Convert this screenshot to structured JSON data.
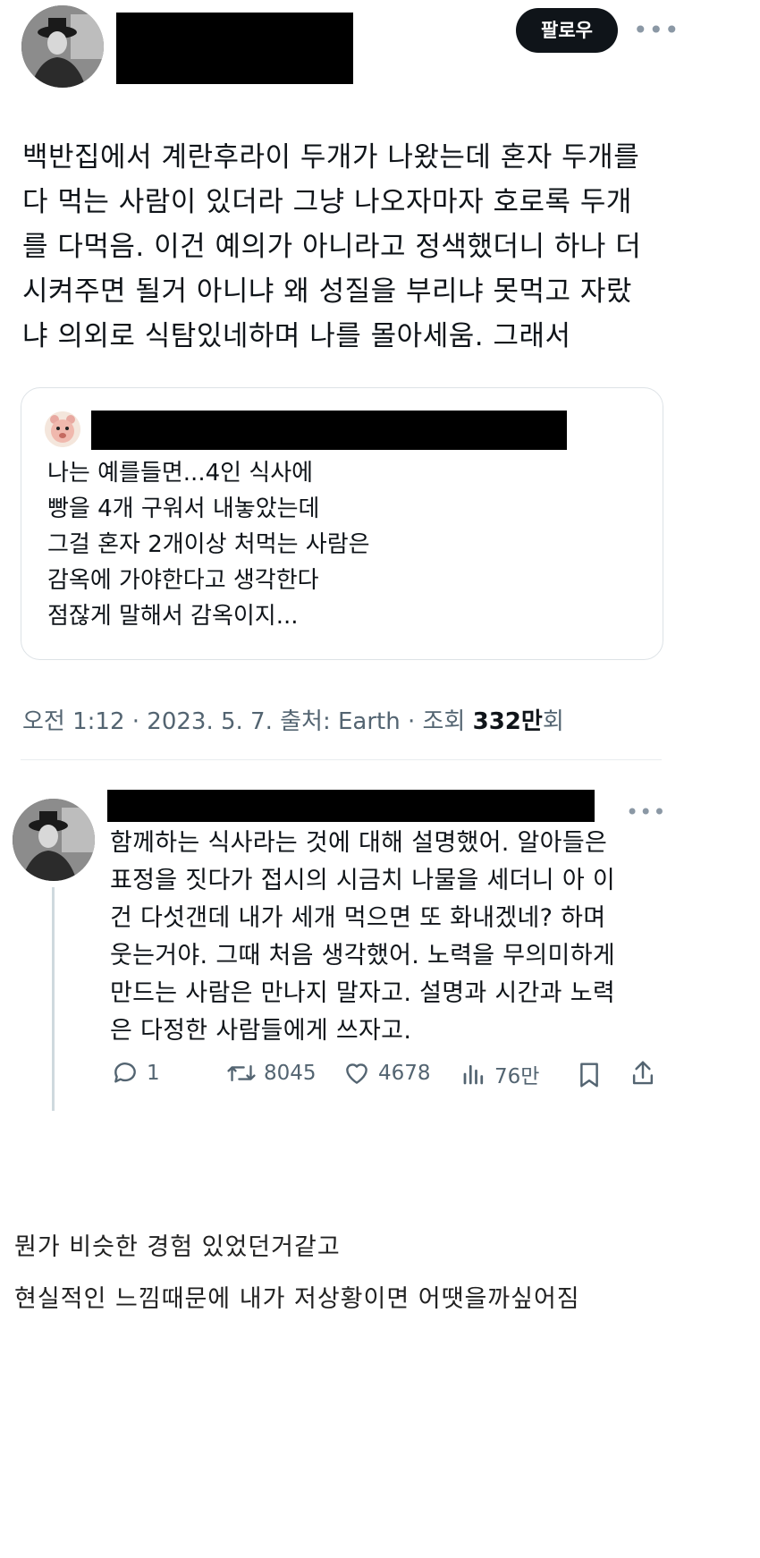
{
  "tweet": {
    "follow_label": "팔로우",
    "more_label": "•••",
    "text_lines": [
      "백반집에서 계란후라이 두개가 나왔는데 혼자 두개를",
      "다 먹는 사람이 있더라 그냥 나오자마자 호로록 두개",
      "를 다먹음. 이건 예의가 아니라고 정색했더니 하나 더",
      "시켜주면 될거 아니냐 왜 성질을 부리냐 못먹고 자랐",
      "냐 의외로 식탐있네하며 나를 몰아세움. 그래서"
    ]
  },
  "quote": {
    "lines": [
      "나는 예를들면...4인 식사에",
      "빵을 4개 구워서 내놓았는데",
      "그걸 혼자 2개이상 처먹는 사람은",
      "감옥에 가야한다고 생각한다",
      "점잖게 말해서 감옥이지..."
    ]
  },
  "meta": {
    "prefix": "오전 1:12 · 2023. 5. 7. 출처: Earth · 조회 ",
    "views": "332만",
    "suffix": "회"
  },
  "reply": {
    "more_label": "•••",
    "text_lines": [
      "함께하는 식사라는 것에 대해 설명했어. 알아들은",
      "표정을 짓다가 접시의 시금치 나물을 세더니 아 이",
      "건 다섯갠데 내가 세개 먹으면 또 화내겠네? 하며",
      "웃는거야. 그때 처음 생각했어. 노력을 무의미하게",
      "만드는 사람은 만나지 말자고. 설명과 시간과 노력",
      "은 다정한 사람들에게 쓰자고."
    ],
    "actions": {
      "replies": "1",
      "retweets": "8045",
      "likes": "4678",
      "views": "76만"
    }
  },
  "comment": {
    "lines": [
      "뭔가 비슷한 경험 있었던거같고",
      "현실적인 느낌때문에 내가 저상황이면 어땟을까싶어짐"
    ]
  }
}
